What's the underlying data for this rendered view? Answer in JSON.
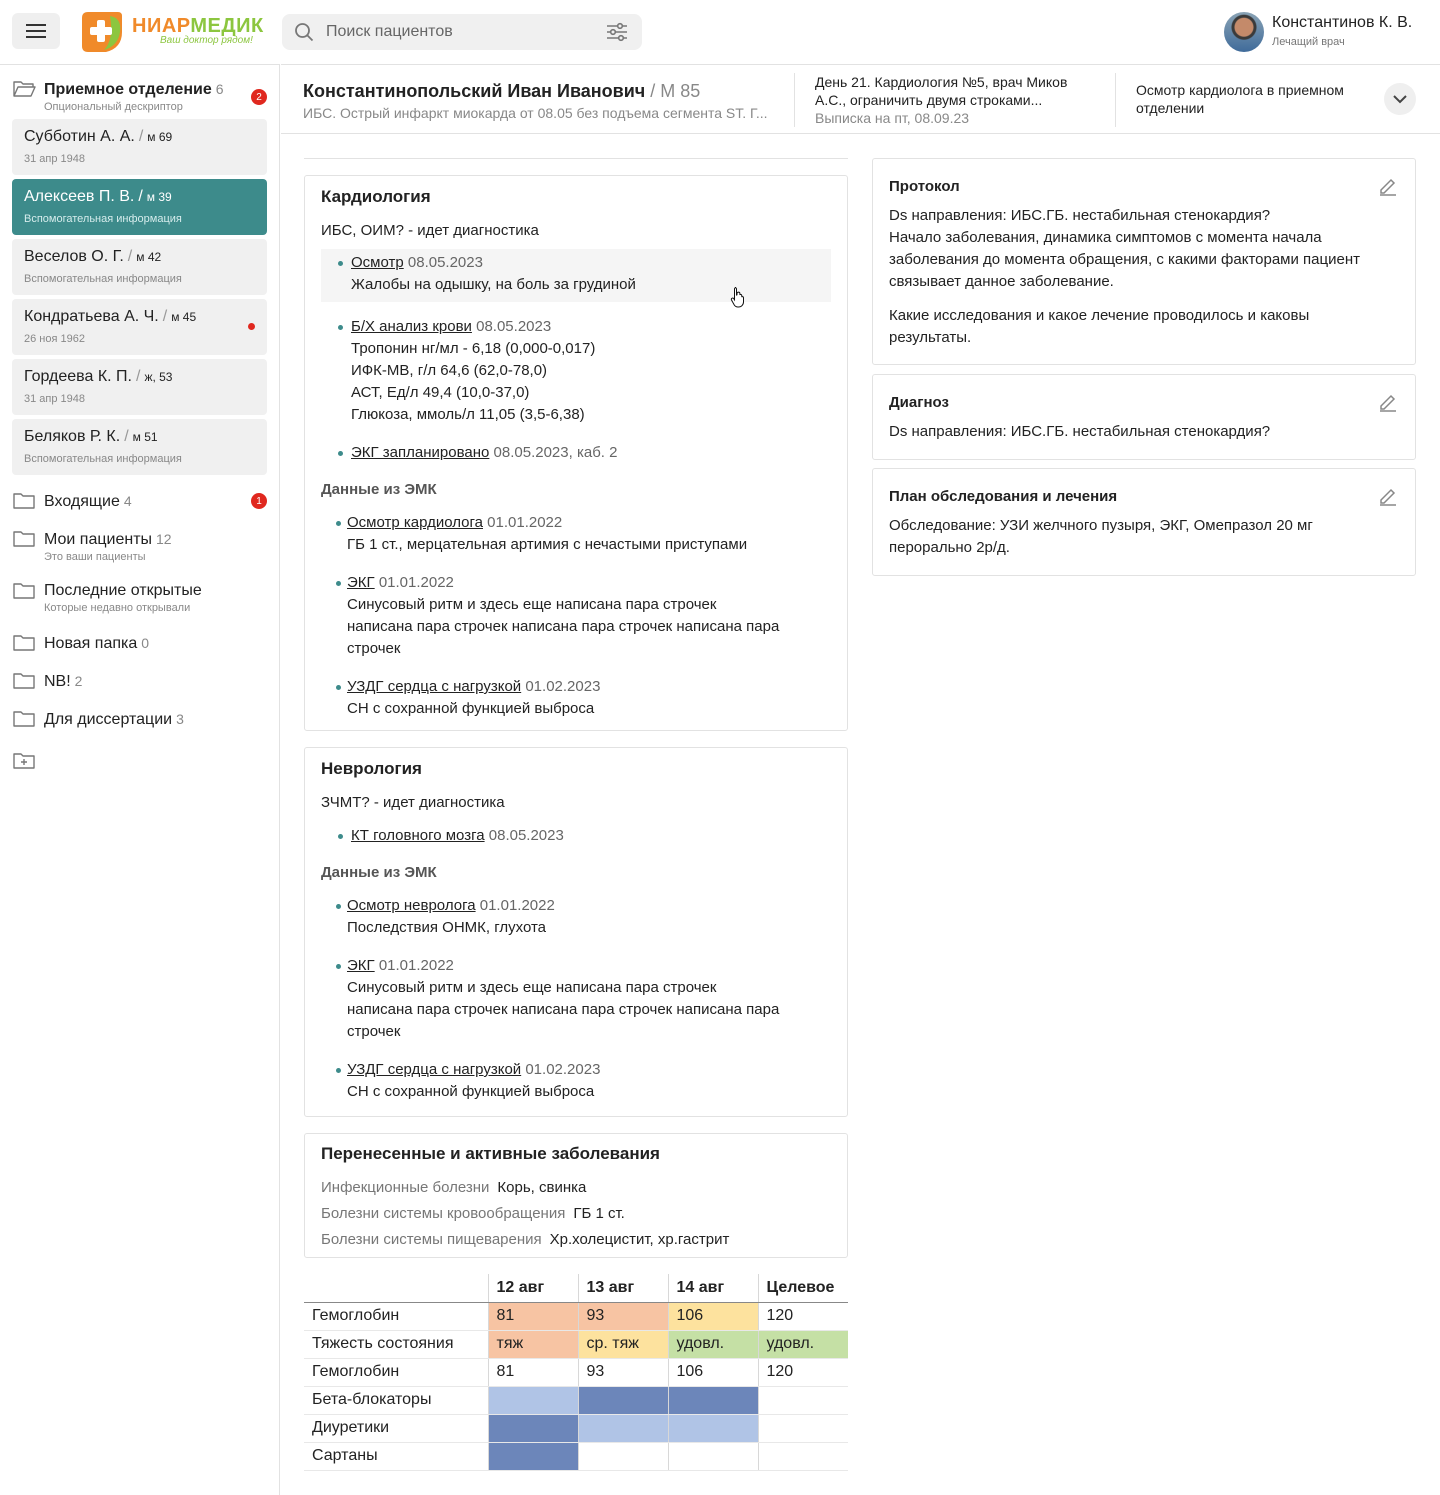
{
  "app": {
    "logo_name_a": "НИАР",
    "logo_name_b": "МЕДИК",
    "logo_tagline": "Ваш доктор рядом!",
    "search_placeholder": "Поиск пациентов",
    "user_name": "Константинов К. В.",
    "user_role": "Лечащий врач",
    "accent_color": "#3d8b8b"
  },
  "sidebar": {
    "department": {
      "label": "Приемное отделение",
      "count": "6",
      "desc": "Опциональный дескриптор",
      "badge": "2"
    },
    "patients": [
      {
        "name": "Субботин А. А.",
        "sex": "м 69",
        "sub": "31 апр 1948"
      },
      {
        "name": "Алексеев П. В.",
        "sex": "м 39",
        "sub": "Вспомогательная информация"
      },
      {
        "name": "Веселов О. Г.",
        "sex": "м 42",
        "sub": "Вспомогательная информация"
      },
      {
        "name": "Кондратьева А. Ч.",
        "sex": "м 45",
        "sub": "26 ноя 1962"
      },
      {
        "name": "Гордеева К. П.",
        "sex": "ж, 53",
        "sub": "31 апр 1948"
      },
      {
        "name": "Беляков Р. К.",
        "sex": "м 51",
        "sub": "Вспомогательная информация"
      }
    ],
    "folders": [
      {
        "label": "Входящие",
        "count": "4",
        "badge": "1"
      },
      {
        "label": "Мои пациенты",
        "count": "12",
        "desc": "Это ваши пациенты"
      },
      {
        "label": "Последние открытые",
        "desc": "Которые недавно открывали"
      },
      {
        "label": "Новая папка",
        "count": "0"
      },
      {
        "label": "NB!",
        "count": "2"
      },
      {
        "label": "Для диссертации",
        "count": "3"
      }
    ]
  },
  "header": {
    "patient_name": "Константинопольский Иван  Иванович",
    "patient_age": " / М 85",
    "diagnosis": "ИБС. Острый инфаркт миокарда от 08.05 без подъема сегмента ST. Г...",
    "col1_line1": "День 21. Кардиология №5, врач Миков",
    "col1_line2": "А.С., ограничить двумя строками...",
    "col1_line3": "Выписка на пт, 08.09.23",
    "col2_line1": "Осмотр кардиолога в приемном",
    "col2_line2": "отделении"
  },
  "cardiology": {
    "title": "Кардиология",
    "status": "ИБС, ОИМ? - идет диагностика",
    "entries": [
      {
        "link": "Осмотр",
        "date": "08.05.2023",
        "lines": [
          "Жалобы на одышку, на боль за грудиной"
        ]
      },
      {
        "link": "Б/Х анализ крови",
        "date": "08.05.2023",
        "lines": [
          "Тропонин нг/мл - 6,18 (0,000-0,017)",
          "ИФК-МВ, г/л 64,6 (62,0-78,0)",
          "АСТ, Ед/л 49,4 (10,0-37,0)",
          "Глюкоза, ммоль/л 11,05 (3,5-6,38)"
        ]
      },
      {
        "link": "ЭКГ запланировано",
        "date": "08.05.2023, каб. 2",
        "lines": []
      }
    ],
    "emk_title": "Данные из ЭМК",
    "emk": [
      {
        "link": "Осмотр кардиолога",
        "date": "01.01.2022",
        "lines": [
          "ГБ 1 ст., мерцательная артимия с нечастыми приступами"
        ]
      },
      {
        "link": "ЭКГ",
        "date": "01.01.2022",
        "lines": [
          "Синусовый ритм и здесь еще написана пара строчек",
          "написана пара строчек написана пара строчек написана пара",
          "строчек"
        ]
      },
      {
        "link": "УЗДГ сердца с нагрузкой",
        "date": "01.02.2023",
        "lines": [
          "СН с сохранной функцией выброса"
        ]
      }
    ]
  },
  "neurology": {
    "title": "Неврология",
    "status": "ЗЧМТ? - идет диагностика",
    "entries": [
      {
        "link": "КТ головного мозга",
        "date": "08.05.2023",
        "lines": []
      }
    ],
    "emk_title": "Данные из ЭМК",
    "emk": [
      {
        "link": "Осмотр невролога",
        "date": "01.01.2022",
        "lines": [
          "Последствия ОНМК, глухота"
        ]
      },
      {
        "link": "ЭКГ",
        "date": "01.01.2022",
        "lines": [
          "Синусовый ритм и здесь еще написана пара строчек",
          "написана пара строчек написана пара строчек написана пара",
          "строчек"
        ]
      },
      {
        "link": "УЗДГ сердца с нагрузкой",
        "date": "01.02.2023",
        "lines": [
          "СН с сохранной функцией выброса"
        ]
      }
    ]
  },
  "diseases": {
    "title": "Перенесенные и активные заболевания",
    "rows": [
      {
        "k": "Инфекционные болезни",
        "v": "Корь, свинка"
      },
      {
        "k": "Болезни системы кровообращения",
        "v": "ГБ 1 ст."
      },
      {
        "k": "Болезни системы пищеварения",
        "v": "Хр.холецистит, хр.гастрит"
      }
    ]
  },
  "lab_table": {
    "headers": [
      "",
      "12 авг",
      "13 авг",
      "14 авг",
      "Целевое"
    ],
    "rows": [
      {
        "label": "Гемоглобин",
        "cells": [
          "81",
          "93",
          "106",
          "120"
        ],
        "colors": [
          "#f7c4a3",
          "#f7c4a3",
          "#fde29e",
          ""
        ]
      },
      {
        "label": "Тяжесть состояния",
        "cells": [
          "тяж",
          "ср. тяж",
          "удовл.",
          "удовл."
        ],
        "colors": [
          "#f7c4a3",
          "#fde29e",
          "#c5e0a5",
          "#c5e0a5"
        ]
      },
      {
        "label": "Гемоглобин",
        "cells": [
          "81",
          "93",
          "106",
          "120"
        ],
        "colors": [
          "",
          "",
          "",
          ""
        ]
      },
      {
        "label": "Бета-блокаторы",
        "cells": [
          "",
          "",
          "",
          ""
        ],
        "colors": [
          "#b0c4e6",
          "#6c86ba",
          "#6c86ba",
          ""
        ]
      },
      {
        "label": "Диуретики",
        "cells": [
          "",
          "",
          "",
          ""
        ],
        "colors": [
          "#6c86ba",
          "#b0c4e6",
          "#b0c4e6",
          ""
        ]
      },
      {
        "label": "Сартаны",
        "cells": [
          "",
          "",
          "",
          ""
        ],
        "colors": [
          "#6c86ba",
          "",
          "",
          ""
        ]
      }
    ]
  },
  "protocol": {
    "title": "Протокол",
    "p1": [
      "Ds направления: ИБС.ГБ. нестабильная стенокардия?",
      "Начало заболевания, динамика симптомов с момента начала",
      "заболевания до момента обращения, с какими факторами пациент",
      "связывает данное заболевание."
    ],
    "p2": [
      "Какие исследования и какое лечение проводилось и каковы",
      "результаты."
    ]
  },
  "diagnosis": {
    "title": "Диагноз",
    "text": "Ds направления: ИБС.ГБ. нестабильная стенокардия?"
  },
  "plan": {
    "title": "План обследования и лечения",
    "lines": [
      "Обследование: УЗИ желчного пузыря, ЭКГ, Омепразол 20 мг",
      "перорально 2р/д."
    ]
  }
}
